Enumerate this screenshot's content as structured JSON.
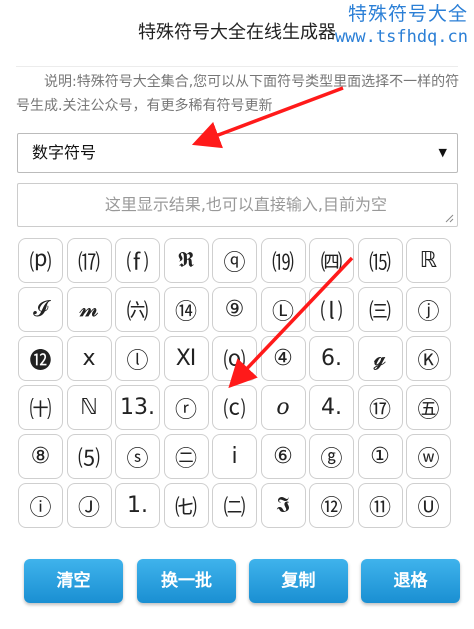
{
  "watermark": {
    "title": "特殊符号大全",
    "url": "www.tsfhdq.cn"
  },
  "header": {
    "title": "特殊符号大全在线生成器"
  },
  "description": "说明:特殊符号大全集合,您可以从下面符号类型里面选择不一样的符号生成.关注公众号，有更多稀有符号更新",
  "type_select": {
    "selected": "数字符号"
  },
  "result_box": {
    "placeholder": "这里显示结果,也可以直接输入,目前为空"
  },
  "symbols": [
    "⒫",
    "⒄",
    "⒡",
    "𝕽",
    "ⓠ",
    "⒆",
    "㈣",
    "⒂",
    "ℝ",
    "𝓘",
    "𝓶",
    "㈥",
    "⑭",
    "⑨",
    "Ⓛ",
    "⒧",
    "㈢",
    "ⓙ",
    "⓬",
    "ⅹ",
    "ⓛ",
    "Ⅺ",
    "⒪",
    "④",
    "6.",
    "𝓰",
    "Ⓚ",
    "㈩",
    "ℕ",
    "13.",
    "ⓡ",
    "⒞",
    "𝑜",
    "4.",
    "⑰",
    "㊄",
    "⑧",
    "⑸",
    "ⓢ",
    "㊁",
    "ⅰ",
    "⑥",
    "ⓖ",
    "①",
    "ⓦ",
    "ⓘ",
    "Ⓙ",
    "1.",
    "㈦",
    "㈡",
    "𝕴",
    "⑫",
    "⑪",
    "Ⓤ"
  ],
  "buttons": {
    "clear": "清空",
    "refresh": "换一批",
    "copy": "复制",
    "back": "退格"
  },
  "colors": {
    "button": "#1f9ee0",
    "annotation_arrow": "#ff1a1a",
    "watermark": "#2b7fd6"
  }
}
